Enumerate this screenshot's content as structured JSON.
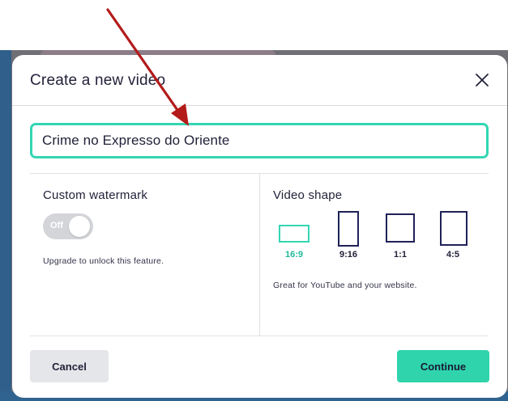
{
  "modal": {
    "title": "Create a new video",
    "close_icon": "close-icon"
  },
  "video_name": {
    "value": "Crime no Expresso do Oriente"
  },
  "watermark": {
    "title": "Custom watermark",
    "toggle_label": "Off",
    "toggle_state": "off",
    "note": "Upgrade to unlock this feature."
  },
  "video_shape": {
    "title": "Video shape",
    "selected": "16:9",
    "options": [
      {
        "label": "16:9"
      },
      {
        "label": "9:16"
      },
      {
        "label": "1:1"
      },
      {
        "label": "4:5"
      }
    ],
    "description": "Great for YouTube and your website."
  },
  "footer": {
    "cancel_label": "Cancel",
    "continue_label": "Continue"
  },
  "colors": {
    "accent": "#33d6b2",
    "primary_button": "#2fd4ad",
    "annotation_arrow": "#b31b1b",
    "shape_outline": "#1f2257"
  }
}
